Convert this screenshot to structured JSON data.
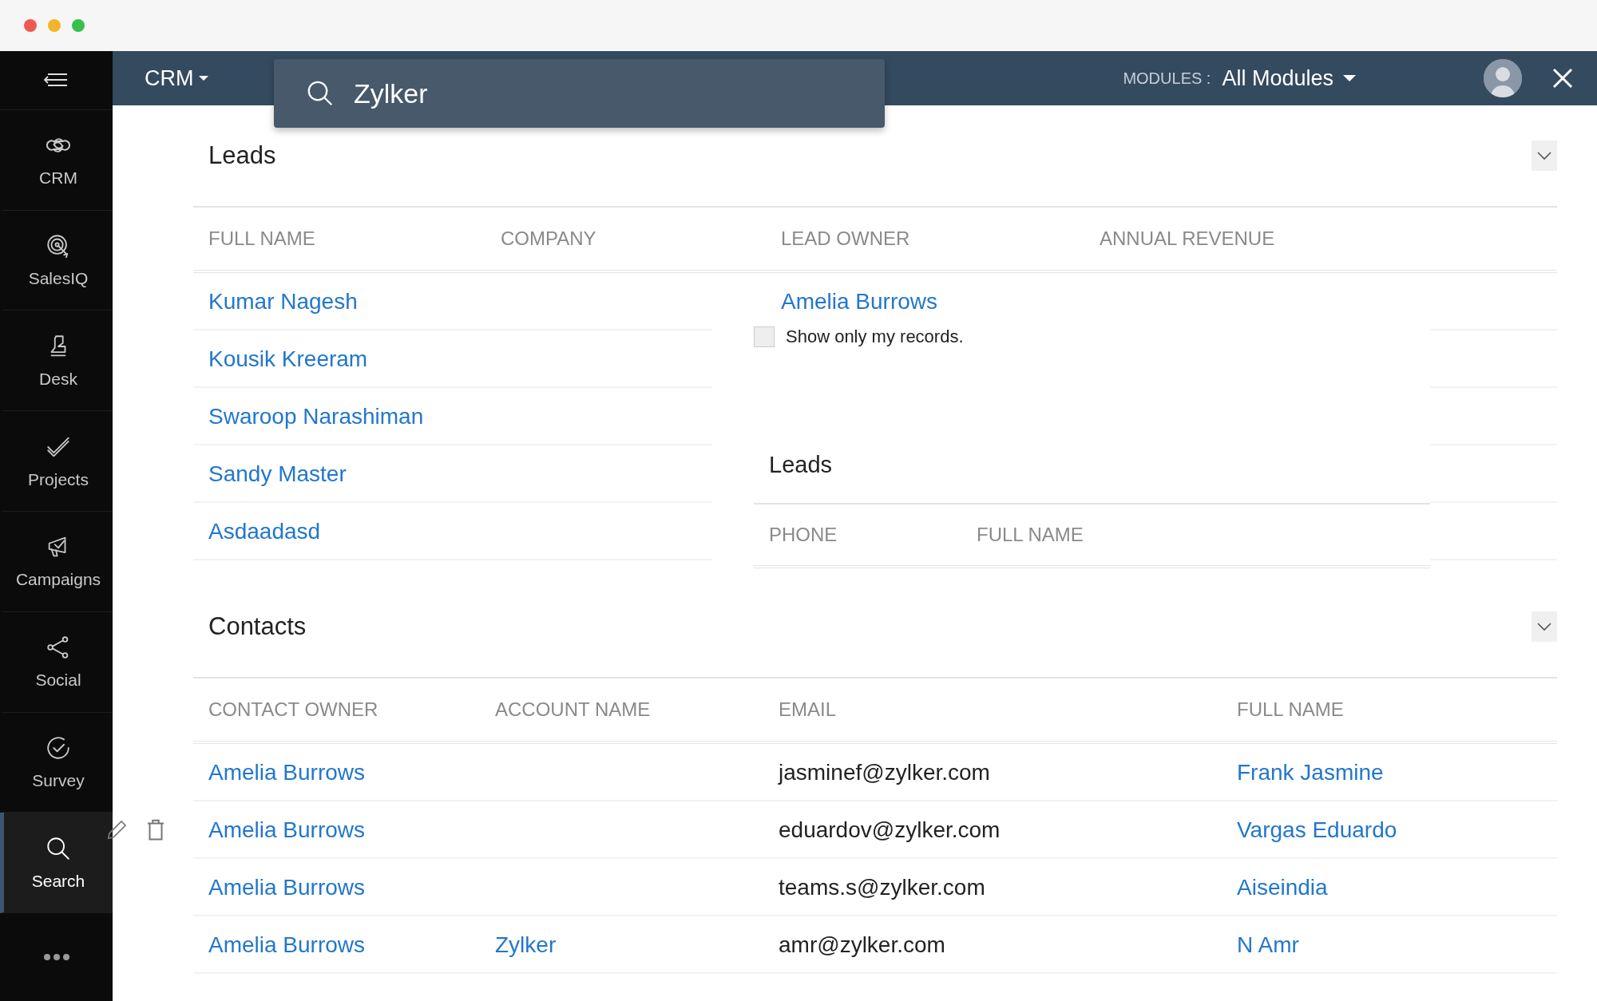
{
  "top_bar": {
    "app_menu": "CRM",
    "search": {
      "value": "Zylker"
    },
    "modules_label": "MODULES :",
    "modules_value": "All Modules"
  },
  "sidebar": {
    "items": [
      {
        "label": "CRM",
        "selected": false
      },
      {
        "label": "SalesIQ",
        "selected": false
      },
      {
        "label": "Desk",
        "selected": false
      },
      {
        "label": "Projects",
        "selected": false
      },
      {
        "label": "Campaigns",
        "selected": false
      },
      {
        "label": "Social",
        "selected": false
      },
      {
        "label": "Survey",
        "selected": false
      },
      {
        "label": "Search",
        "selected": true
      }
    ]
  },
  "sections": [
    {
      "title": "Leads",
      "expanded": true,
      "columns": [
        {
          "label": "FULL NAME",
          "kind": "link"
        },
        {
          "label": "COMPANY"
        },
        {
          "label": "LEAD OWNER",
          "kind": "link"
        },
        {
          "label": "ANNUAL REVENUE"
        }
      ],
      "rows": [
        {
          "cells": [
            "Kumar Nagesh",
            null,
            "Amelia Burrows",
            null
          ],
          "show_actions": false
        },
        {
          "cells": [
            "Kousik Kreeram",
            null,
            null,
            null
          ],
          "show_actions": false
        },
        {
          "cells": [
            "Swaroop Narashiman",
            null,
            null,
            null
          ],
          "show_actions": false
        },
        {
          "cells": [
            "Sandy Master",
            null,
            null,
            null
          ],
          "show_actions": false
        },
        {
          "cells": [
            "Asdaadasd",
            null,
            null,
            null
          ],
          "show_actions": false
        }
      ],
      "lookup_popup": {
        "checkbox": {
          "label": "Show only my records.",
          "checked": false
        },
        "title": "Leads",
        "columns": [
          "PHONE",
          "FULL NAME"
        ]
      }
    },
    {
      "title": "Contacts",
      "expanded": true,
      "columns": [
        {
          "label": "CONTACT OWNER",
          "kind": "link"
        },
        {
          "label": "ACCOUNT NAME",
          "kind": "link"
        },
        {
          "label": "EMAIL",
          "kind": "text"
        },
        {
          "label": "FULL NAME",
          "kind": "link"
        }
      ],
      "rows": [
        {
          "cells": [
            "Amelia Burrows",
            null,
            "jasminef@zylker.com",
            "Frank Jasmine"
          ],
          "show_actions": false
        },
        {
          "cells": [
            "Amelia Burrows",
            null,
            "eduardov@zylker.com",
            "Vargas Eduardo"
          ],
          "show_actions": true
        },
        {
          "cells": [
            "Amelia Burrows",
            null,
            "teams.s@zylker.com",
            "Aiseindia"
          ],
          "show_actions": false
        },
        {
          "cells": [
            "Amelia Burrows",
            "Zylker",
            "amr@zylker.com",
            "N Amr"
          ],
          "show_actions": false
        }
      ]
    }
  ]
}
